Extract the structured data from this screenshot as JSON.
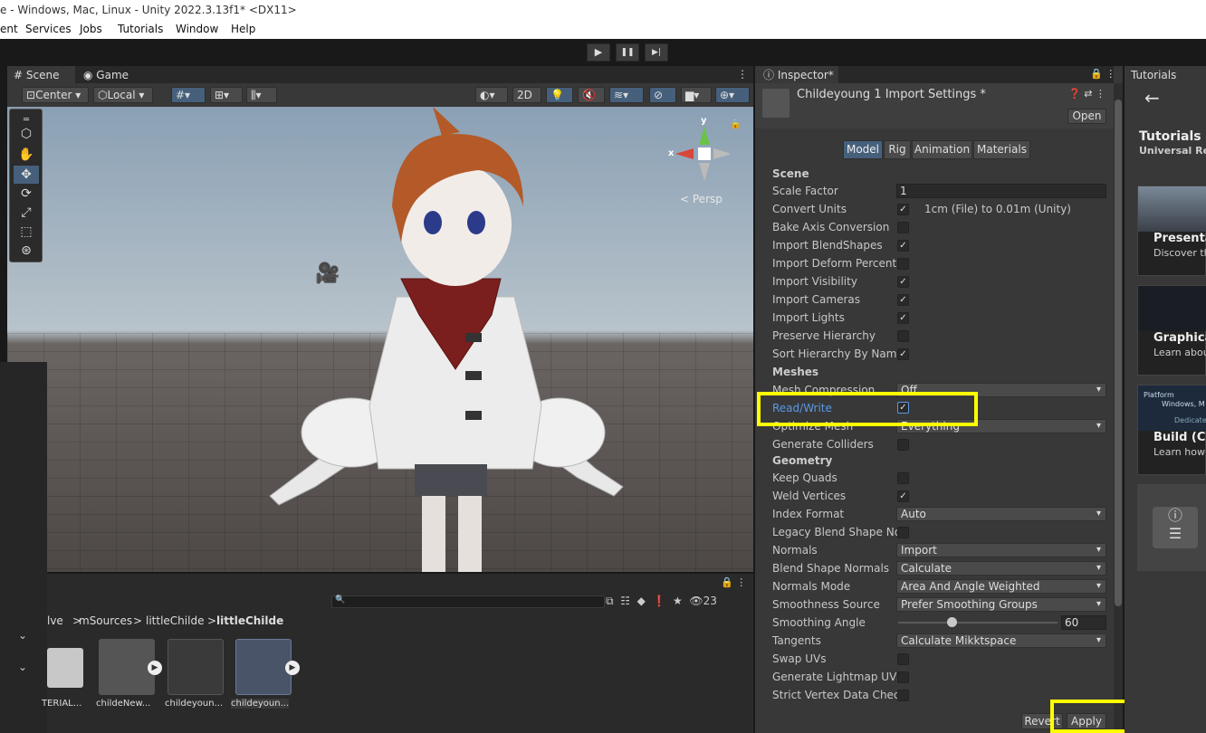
{
  "window": {
    "title": "e - Windows, Mac, Linux - Unity 2022.3.13f1* <DX11>"
  },
  "menu": [
    "ent",
    "Services",
    "Jobs",
    "Tutorials",
    "Window",
    "Help"
  ],
  "playbar": {
    "play": "▶",
    "pause": "❚❚",
    "step": "▶|"
  },
  "scene_tabs": {
    "scene": "Scene",
    "game": "Game"
  },
  "scene_toolbar": {
    "pivot": "Center",
    "space": "Local",
    "mode2d": "2D",
    "persp": "Persp",
    "axis_x": "x",
    "axis_y": "y"
  },
  "project": {
    "count": "23",
    "breadcrumb": [
      "lve",
      "mSources",
      "littleChilde",
      "littleChilde"
    ],
    "assets": [
      "TERIAL...",
      "childeNew...",
      "childeyoun...",
      "childeyoun..."
    ]
  },
  "inspector": {
    "tab": "Inspector*",
    "title": "Childeyoung 1 Import Settings *",
    "open": "Open",
    "tabs": [
      "Model",
      "Rig",
      "Animation",
      "Materials"
    ],
    "scene_header": "Scene",
    "scale_factor_label": "Scale Factor",
    "scale_factor_value": "1",
    "convert_units_label": "Convert Units",
    "convert_units_note": "1cm (File) to 0.01m (Unity)",
    "bake_axis": "Bake Axis Conversion",
    "import_blendshapes": "Import BlendShapes",
    "import_deform": "Import Deform Percent",
    "import_visibility": "Import Visibility",
    "import_cameras": "Import Cameras",
    "import_lights": "Import Lights",
    "preserve_hierarchy": "Preserve Hierarchy",
    "sort_hierarchy": "Sort Hierarchy By Name",
    "meshes_header": "Meshes",
    "mesh_compression_label": "Mesh Compression",
    "mesh_compression_value": "Off",
    "read_write": "Read/Write",
    "optimize_mesh_label": "Optimize Mesh",
    "optimize_mesh_value": "Everything",
    "generate_colliders": "Generate Colliders",
    "geometry_header": "Geometry",
    "keep_quads": "Keep Quads",
    "weld_vertices": "Weld Vertices",
    "index_format_label": "Index Format",
    "index_format_value": "Auto",
    "legacy_blend": "Legacy Blend Shape No",
    "normals_label": "Normals",
    "normals_value": "Import",
    "blend_normals_label": "Blend Shape Normals",
    "blend_normals_value": "Calculate",
    "normals_mode_label": "Normals Mode",
    "normals_mode_value": "Area And Angle Weighted",
    "smoothness_label": "Smoothness Source",
    "smoothness_value": "Prefer Smoothing Groups",
    "smoothing_angle_label": "Smoothing Angle",
    "smoothing_angle_value": "60",
    "tangents_label": "Tangents",
    "tangents_value": "Calculate Mikktspace",
    "swap_uvs": "Swap UVs",
    "lightmap_uvs": "Generate Lightmap UVs",
    "strict_vertex": "Strict Vertex Data Check",
    "revert": "Revert",
    "apply": "Apply"
  },
  "tutorials": {
    "tab": "Tutorials",
    "title": "Tutorials",
    "subtitle": "Universal Ren",
    "cards": [
      {
        "title": "Presenta",
        "sub": "Discover th"
      },
      {
        "title": "Graphica",
        "sub": "Learn abou"
      },
      {
        "title": "Build (Co",
        "sub": "Learn how"
      }
    ],
    "platform_label": "Platform",
    "platform_sub": "Windows, M",
    "dedicated": "Dedicated"
  },
  "colors": {
    "highlight": "#ffff00",
    "accent": "#46607c",
    "panel": "#383838"
  }
}
